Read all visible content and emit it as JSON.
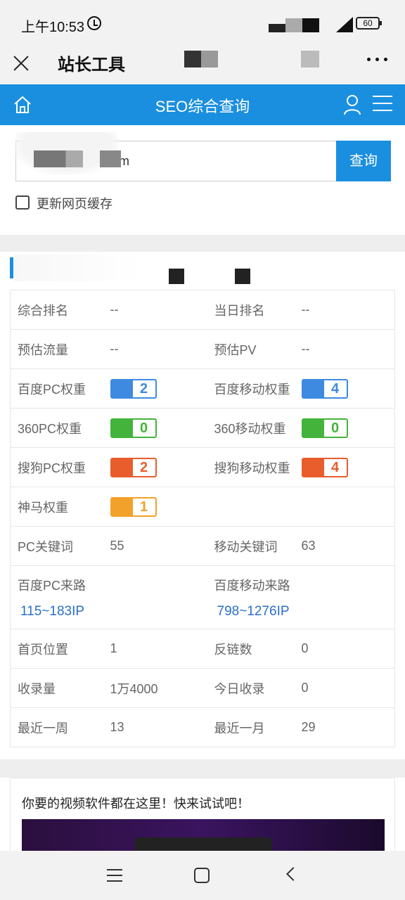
{
  "status_bar": {
    "time": "上午10:53",
    "battery": "60"
  },
  "title_bar": {
    "title": "站长工具"
  },
  "seo_header": {
    "title": "SEO综合查询"
  },
  "search": {
    "input_value": "m",
    "button_label": "查询"
  },
  "cache_option": {
    "label": "更新网页缓存",
    "checked": false
  },
  "stats_rows": [
    {
      "k1": "综合排名",
      "v1": "--",
      "k2": "当日排名",
      "v2": "--"
    },
    {
      "k1": "预估流量",
      "v1": "--",
      "k2": "预估PV",
      "v2": "--"
    },
    {
      "k1": "百度PC权重",
      "b1": "2",
      "k2": "百度移动权重",
      "b2": "4"
    },
    {
      "k1": "360PC权重",
      "b1": "0",
      "k2": "360移动权重",
      "b2": "0"
    },
    {
      "k1": "搜狗PC权重",
      "b1": "2",
      "k2": "搜狗移动权重",
      "b2": "4"
    },
    {
      "k1": "神马权重",
      "b1": "1"
    },
    {
      "k1": "PC关键词",
      "v1": "55",
      "k2": "移动关键词",
      "v2": "63"
    },
    {
      "k1": "百度PC来路",
      "v1": "115~183IP",
      "k2": "百度移动来路",
      "v2": "798~1276IP"
    },
    {
      "k1": "首页位置",
      "v1": "1",
      "k2": "反链数",
      "v2": "0"
    },
    {
      "k1": "收录量",
      "v1": "1万4000",
      "k2": "今日收录",
      "v2": "0"
    },
    {
      "k1": "最近一周",
      "v1": "13",
      "k2": "最近一月",
      "v2": "29"
    }
  ],
  "ad": {
    "title": "你要的视频软件都在这里！快来试试吧！"
  },
  "colors": {
    "accent": "#1a8fe0",
    "baidu": "#3d8ae0",
    "so360": "#44b33c",
    "sogou": "#e85d2b",
    "shenma": "#f2a12a"
  }
}
